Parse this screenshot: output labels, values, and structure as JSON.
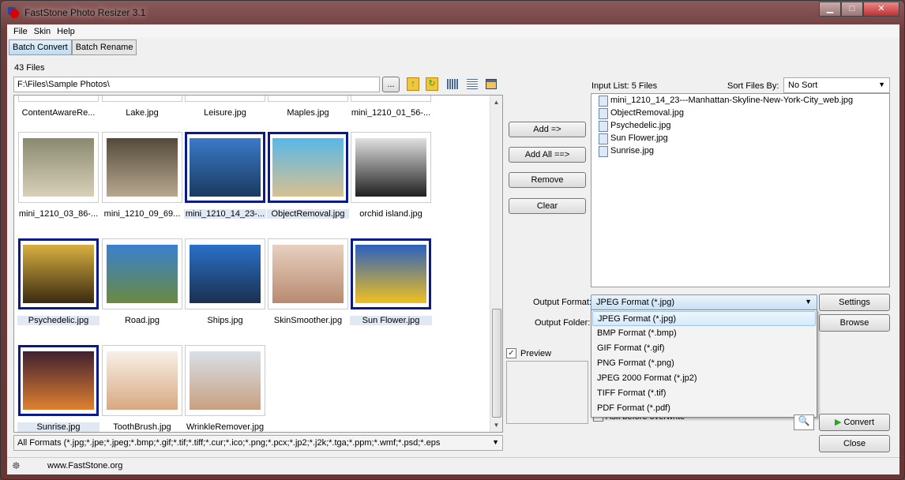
{
  "window": {
    "title": "FastStone Photo Resizer 3.1",
    "minimize": "▁",
    "maximize": "□",
    "close": "✕"
  },
  "menu": [
    "File",
    "Skin",
    "Help"
  ],
  "tabs": [
    {
      "label": "Batch Convert",
      "active": true
    },
    {
      "label": "Batch Rename",
      "active": false
    }
  ],
  "files_count": "43 Files",
  "path": {
    "value": "F:\\Files\\Sample Photos\\",
    "browse": "..."
  },
  "thumbnails": [
    {
      "name": "ContentAwareRe...",
      "row": 0,
      "selected": false
    },
    {
      "name": "Lake.jpg",
      "row": 0,
      "selected": false
    },
    {
      "name": "Leisure.jpg",
      "row": 0,
      "selected": false
    },
    {
      "name": "Maples.jpg",
      "row": 0,
      "selected": false
    },
    {
      "name": "mini_1210_01_56-...",
      "row": 0,
      "selected": false
    },
    {
      "name": "mini_1210_03_86-...",
      "selected": false,
      "colors": [
        "#8a8a70",
        "#d8d0b8"
      ]
    },
    {
      "name": "mini_1210_09_69...",
      "selected": false,
      "colors": [
        "#554a3a",
        "#b8a890"
      ]
    },
    {
      "name": "mini_1210_14_23-...",
      "selected": true,
      "colors": [
        "#3a7ac8",
        "#1a3a60"
      ]
    },
    {
      "name": "ObjectRemoval.jpg",
      "selected": true,
      "colors": [
        "#58b8e8",
        "#d8c090"
      ]
    },
    {
      "name": "orchid island.jpg",
      "selected": false,
      "colors": [
        "#e0e0e0",
        "#202020"
      ]
    },
    {
      "name": "Psychedelic.jpg",
      "selected": true,
      "colors": [
        "#d8b040",
        "#3a2a10"
      ]
    },
    {
      "name": "Road.jpg",
      "selected": false,
      "colors": [
        "#3a80d0",
        "#6a8a40"
      ]
    },
    {
      "name": "Ships.jpg",
      "selected": false,
      "colors": [
        "#2a70c8",
        "#1a3050"
      ]
    },
    {
      "name": "SkinSmoother.jpg",
      "selected": false,
      "colors": [
        "#e8d0c0",
        "#b88a70"
      ]
    },
    {
      "name": "Sun Flower.jpg",
      "selected": true,
      "colors": [
        "#2a60c0",
        "#f0c020"
      ]
    },
    {
      "name": "Sunrise.jpg",
      "selected": true,
      "colors": [
        "#402030",
        "#e08030"
      ]
    },
    {
      "name": "ToothBrush.jpg",
      "selected": false,
      "colors": [
        "#f8f0e8",
        "#d8a880"
      ]
    },
    {
      "name": "WrinkleRemover.jpg",
      "selected": false,
      "colors": [
        "#d8e0e8",
        "#c8a080"
      ]
    }
  ],
  "filter": "All Formats (*.jpg;*.jpe;*.jpeg;*.bmp;*.gif;*.tif;*.tiff;*.cur;*.ico;*.png;*.pcx;*.jp2;*.j2k;*.tga;*.ppm;*.wmf;*.psd;*.eps",
  "buttons": {
    "add": "Add =>",
    "add_all": "Add All ==>",
    "remove": "Remove",
    "clear": "Clear",
    "settings": "Settings",
    "browse": "Browse",
    "convert": "Convert",
    "close": "Close"
  },
  "input_list": {
    "label": "Input List:  5 Files",
    "sort_label": "Sort Files By:",
    "sort_value": "No Sort",
    "files": [
      "mini_1210_14_23---Manhattan-Skyline-New-York-City_web.jpg",
      "ObjectRemoval.jpg",
      "Psychedelic.jpg",
      "Sun Flower.jpg",
      "Sunrise.jpg"
    ]
  },
  "output_format": {
    "label": "Output Format:",
    "value": "JPEG Format (*.jpg)",
    "options": [
      "JPEG Format (*.jpg)",
      "BMP Format (*.bmp)",
      "GIF Format (*.gif)",
      "PNG Format (*.png)",
      "JPEG 2000 Format (*.jp2)",
      "TIFF Format (*.tif)",
      "PDF Format (*.pdf)"
    ]
  },
  "output_folder_label": "Output Folder:",
  "preview": {
    "label": "Preview",
    "checked": true
  },
  "ask_overwrite": {
    "label": "Ask before overwrite",
    "checked": true
  },
  "status": {
    "website": "www.FastStone.org"
  }
}
